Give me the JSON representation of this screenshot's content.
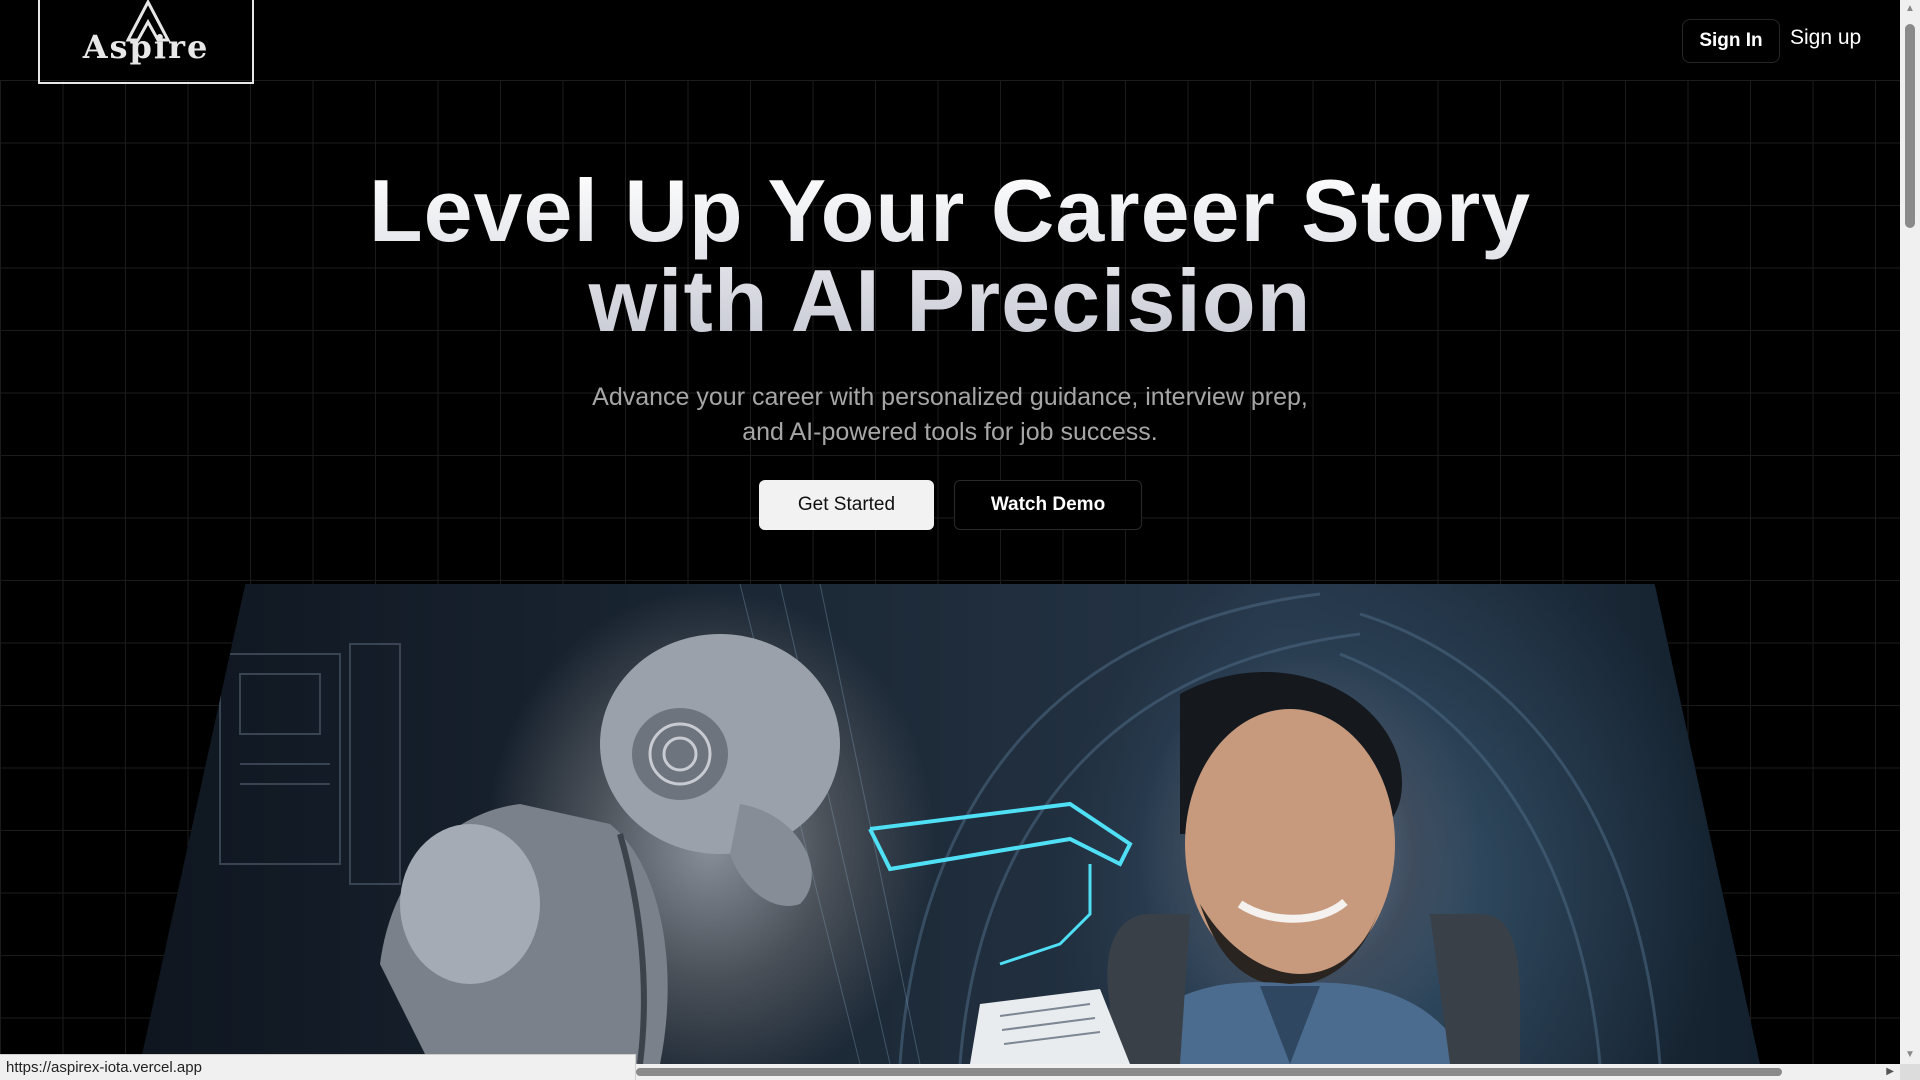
{
  "header": {
    "logo_text": "Aspire",
    "signin_label": "Sign In",
    "signup_label": "Sign up"
  },
  "hero": {
    "title_line1": "Level Up Your Career Story",
    "title_line2": "with AI Precision",
    "subtitle": "Advance your career with personalized guidance, interview prep, and AI-powered tools for job success.",
    "primary_cta": "Get Started",
    "secondary_cta": "Watch Demo"
  },
  "status_bar": {
    "url": "https://aspirex-iota.vercel.app"
  },
  "colors": {
    "background": "#000000",
    "primary_button": "#f2f2f2",
    "grid_line": "#1b1b1b",
    "subtitle": "#a6a6a6"
  },
  "icons": [
    "logo-emblem",
    "scroll-up-arrow",
    "scroll-down-arrow",
    "scroll-right-arrow"
  ]
}
